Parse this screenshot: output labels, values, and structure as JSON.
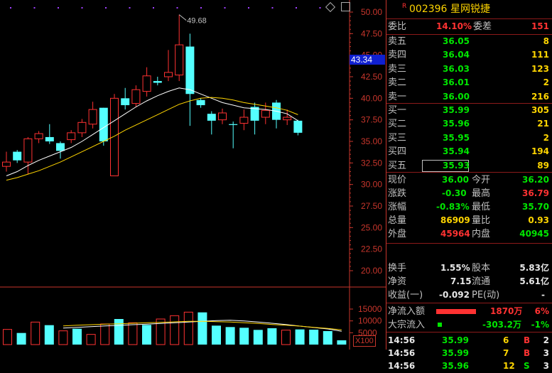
{
  "stock": {
    "badge": "R",
    "code": "002396",
    "name": "星网锐捷"
  },
  "orderbook": {
    "weibi_label": "委比",
    "weibi_value": "14.10%",
    "weicha_label": "委差",
    "weicha_value": "151",
    "asks": [
      {
        "label": "卖五",
        "price": "36.05",
        "volume": "8"
      },
      {
        "label": "卖四",
        "price": "36.04",
        "volume": "111"
      },
      {
        "label": "卖三",
        "price": "36.03",
        "volume": "123"
      },
      {
        "label": "卖二",
        "price": "36.01",
        "volume": "2"
      },
      {
        "label": "卖一",
        "price": "36.00",
        "volume": "216"
      }
    ],
    "bids": [
      {
        "label": "买一",
        "price": "35.99",
        "volume": "305"
      },
      {
        "label": "买二",
        "price": "35.96",
        "volume": "21"
      },
      {
        "label": "买三",
        "price": "35.95",
        "volume": "2"
      },
      {
        "label": "买四",
        "price": "35.94",
        "volume": "194"
      },
      {
        "label": "买五",
        "price": "35.93",
        "volume": "89"
      }
    ]
  },
  "quote": {
    "now_label": "现价",
    "now_value": "36.00",
    "open_label": "今开",
    "open_value": "36.20",
    "chg_label": "涨跌",
    "chg_value": "-0.30",
    "high_label": "最高",
    "high_value": "36.79",
    "pct_label": "涨幅",
    "pct_value": "-0.83%",
    "low_label": "最低",
    "low_value": "35.70",
    "vol_label": "总量",
    "vol_value": "86909",
    "ratio_label": "量比",
    "ratio_value": "0.93",
    "out_label": "外盘",
    "out_value": "45964",
    "in_label": "内盘",
    "in_value": "40945"
  },
  "fundamentals": {
    "turnover_label": "换手",
    "turnover_value": "1.55%",
    "capital_label": "股本",
    "capital_value": "5.83亿",
    "nav_label": "净资",
    "nav_value": "7.15",
    "float_label": "流通",
    "float_value": "5.61亿",
    "eps_label": "收益(一)",
    "eps_value": "-0.092",
    "pe_label": "PE(动)",
    "pe_value": "-"
  },
  "flows": {
    "net_label": "净流入额",
    "net_value": "1870万",
    "net_pct": "6%",
    "block_label": "大宗流入",
    "block_value": "-303.2万",
    "block_pct": "-1%"
  },
  "ticks": [
    {
      "time": "14:56",
      "price": "35.99",
      "volume": "6",
      "side": "B",
      "count": "2"
    },
    {
      "time": "14:56",
      "price": "35.99",
      "volume": "7",
      "side": "B",
      "count": "3"
    },
    {
      "time": "14:56",
      "price": "35.96",
      "volume": "12",
      "side": "S",
      "count": "3"
    }
  ],
  "chart": {
    "price_axis": [
      "50.00",
      "47.50",
      "45.00",
      "42.50",
      "40.00",
      "37.50",
      "35.00",
      "32.50",
      "30.00",
      "27.50",
      "25.00",
      "22.50",
      "20.00"
    ],
    "volume_axis": [
      "15000",
      "10000",
      "5000"
    ],
    "volume_unit": "X100",
    "current_price_tag": "43.34",
    "high_annotation": "49.68",
    "colors": {
      "up": "#ff3232",
      "down": "#54ffff",
      "ma_white": "#ffffff",
      "ma_yellow": "#ffd500",
      "axis": "#c8362c"
    }
  },
  "chart_data": {
    "type": "candlestick",
    "price_ylim": [
      20.0,
      50.0
    ],
    "volume_ylim": [
      0,
      15000
    ],
    "candles": [
      {
        "o": 32.1,
        "h": 33.8,
        "l": 31.5,
        "c": 32.6,
        "up": true
      },
      {
        "o": 33.8,
        "h": 34.0,
        "l": 32.5,
        "c": 32.8,
        "up": false
      },
      {
        "o": 32.6,
        "h": 35.5,
        "l": 31.2,
        "c": 35.3,
        "up": true
      },
      {
        "o": 35.3,
        "h": 36.2,
        "l": 34.8,
        "c": 35.9,
        "up": true
      },
      {
        "o": 35.5,
        "h": 37.0,
        "l": 34.7,
        "c": 35.0,
        "up": false
      },
      {
        "o": 33.9,
        "h": 35.0,
        "l": 33.0,
        "c": 34.8,
        "up": false
      },
      {
        "o": 35.2,
        "h": 36.3,
        "l": 34.8,
        "c": 36.0,
        "up": true
      },
      {
        "o": 36.0,
        "h": 37.6,
        "l": 35.5,
        "c": 37.2,
        "up": true
      },
      {
        "o": 37.0,
        "h": 39.6,
        "l": 36.5,
        "c": 38.7,
        "up": true
      },
      {
        "o": 38.9,
        "h": 38.9,
        "l": 34.5,
        "c": 35.0,
        "up": false
      },
      {
        "o": 31.0,
        "h": 40.5,
        "l": 31.0,
        "c": 40.0,
        "up": true
      },
      {
        "o": 40.0,
        "h": 41.2,
        "l": 38.7,
        "c": 39.2,
        "up": false
      },
      {
        "o": 39.4,
        "h": 41.5,
        "l": 39.0,
        "c": 41.0,
        "up": true
      },
      {
        "o": 40.8,
        "h": 43.6,
        "l": 40.2,
        "c": 42.6,
        "up": true
      },
      {
        "o": 42.0,
        "h": 42.5,
        "l": 41.5,
        "c": 41.8,
        "up": false
      },
      {
        "o": 42.5,
        "h": 45.6,
        "l": 42.0,
        "c": 43.0,
        "up": true
      },
      {
        "o": 42.7,
        "h": 49.7,
        "l": 42.0,
        "c": 46.2,
        "up": true
      },
      {
        "o": 46.0,
        "h": 47.5,
        "l": 36.8,
        "c": 40.5,
        "up": false
      },
      {
        "o": 39.8,
        "h": 40.0,
        "l": 38.9,
        "c": 39.2,
        "up": false
      },
      {
        "o": 38.2,
        "h": 38.5,
        "l": 35.8,
        "c": 37.4,
        "up": false
      },
      {
        "o": 37.5,
        "h": 38.8,
        "l": 37.0,
        "c": 38.3,
        "up": true
      },
      {
        "o": 37.0,
        "h": 37.3,
        "l": 34.2,
        "c": 36.9,
        "up": false
      },
      {
        "o": 37.1,
        "h": 38.7,
        "l": 36.3,
        "c": 37.8,
        "up": true
      },
      {
        "o": 39.0,
        "h": 39.5,
        "l": 35.8,
        "c": 37.4,
        "up": false
      },
      {
        "o": 37.8,
        "h": 39.5,
        "l": 37.0,
        "c": 38.6,
        "up": true
      },
      {
        "o": 39.5,
        "h": 39.8,
        "l": 36.5,
        "c": 37.5,
        "up": false
      },
      {
        "o": 37.5,
        "h": 38.7,
        "l": 36.9,
        "c": 37.8,
        "up": true
      },
      {
        "o": 37.4,
        "h": 37.5,
        "l": 35.7,
        "c": 36.0,
        "up": false
      }
    ],
    "ma_short": [
      31.0,
      31.5,
      32.2,
      32.8,
      33.3,
      33.8,
      34.3,
      35.0,
      35.8,
      36.6,
      37.4,
      38.2,
      39.0,
      39.7,
      40.3,
      40.8,
      41.2,
      41.0,
      40.5,
      40.0,
      39.5,
      39.2,
      38.9,
      38.8,
      38.7,
      38.5,
      38.2,
      37.4
    ],
    "ma_long": [
      30.5,
      30.8,
      31.2,
      31.6,
      32.1,
      32.6,
      33.2,
      33.8,
      34.4,
      35.0,
      35.6,
      36.3,
      36.9,
      37.5,
      38.1,
      38.7,
      39.3,
      39.7,
      40.0,
      40.1,
      40.0,
      39.8,
      39.5,
      39.3,
      39.1,
      38.9,
      38.6,
      38.1
    ],
    "volumes": [
      {
        "v": 6400,
        "up": true
      },
      {
        "v": 4900,
        "up": false
      },
      {
        "v": 9500,
        "up": true
      },
      {
        "v": 8200,
        "up": false
      },
      {
        "v": 5800,
        "up": true
      },
      {
        "v": 6700,
        "up": false
      },
      {
        "v": 4300,
        "up": true
      },
      {
        "v": 8700,
        "up": true
      },
      {
        "v": 10800,
        "up": false
      },
      {
        "v": 9200,
        "up": true
      },
      {
        "v": 8300,
        "up": false
      },
      {
        "v": 10800,
        "up": true
      },
      {
        "v": 12200,
        "up": true
      },
      {
        "v": 13700,
        "up": true
      },
      {
        "v": 13600,
        "up": false
      },
      {
        "v": 8000,
        "up": false
      },
      {
        "v": 7400,
        "up": false
      },
      {
        "v": 7100,
        "up": false
      },
      {
        "v": 6200,
        "up": false
      },
      {
        "v": 6900,
        "up": false
      },
      {
        "v": 6100,
        "up": true
      },
      {
        "v": 6400,
        "up": false
      },
      {
        "v": 6300,
        "up": false
      },
      {
        "v": 5700,
        "up": false
      },
      {
        "v": 1800,
        "up": false
      }
    ],
    "vol_ma_short": [
      7000,
      7300,
      7600,
      7900,
      8100,
      8400,
      8600,
      8900,
      9200,
      9500,
      9800,
      10100,
      10300,
      10000,
      9500,
      9000,
      8500,
      7800,
      7200,
      6600,
      5600
    ],
    "vol_ma_long": [
      7900,
      8200,
      8400,
      8600,
      8800,
      9000,
      9200,
      9400,
      9600,
      9800,
      9800,
      9700,
      9500,
      9200,
      8900,
      8500,
      8200,
      7800,
      7300,
      6800,
      6200
    ]
  }
}
